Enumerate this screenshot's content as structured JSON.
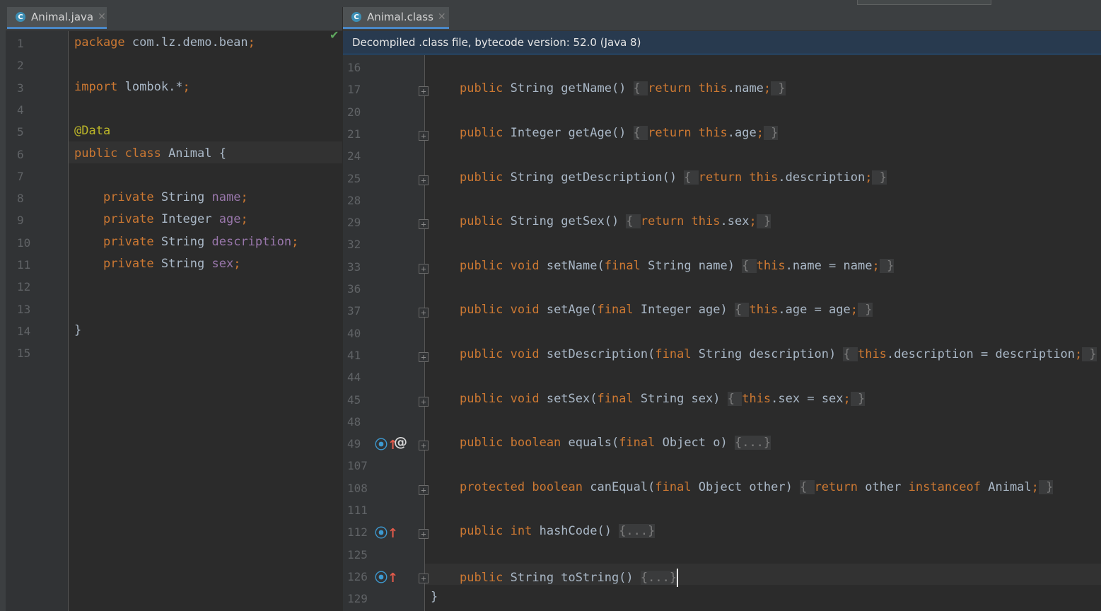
{
  "tabs": {
    "left": {
      "label": "Animal.java",
      "icon": "C"
    },
    "right": {
      "label": "Animal.class",
      "icon": "C"
    }
  },
  "banner": "Decompiled .class file, bytecode version: 52.0 (Java 8)",
  "left_editor": {
    "line_numbers": [
      "1",
      "2",
      "3",
      "4",
      "5",
      "6",
      "7",
      "8",
      "9",
      "10",
      "11",
      "12",
      "13",
      "14",
      "15"
    ],
    "lines": [
      {
        "n": "1",
        "tokens": [
          [
            "kw",
            "package"
          ],
          [
            "pl",
            " com.lz.demo.bean"
          ],
          [
            "kw",
            ";"
          ]
        ]
      },
      {
        "n": "2",
        "tokens": []
      },
      {
        "n": "3",
        "tokens": [
          [
            "kw",
            "import"
          ],
          [
            "pl",
            " lombok.*"
          ],
          [
            "kw",
            ";"
          ]
        ]
      },
      {
        "n": "4",
        "tokens": []
      },
      {
        "n": "5",
        "tokens": [
          [
            "ann",
            "@Data"
          ]
        ]
      },
      {
        "n": "6",
        "tokens": [
          [
            "kw",
            "public class"
          ],
          [
            "pl",
            " Animal {"
          ]
        ]
      },
      {
        "n": "7",
        "tokens": []
      },
      {
        "n": "8",
        "tokens": [
          [
            "pl",
            "    "
          ],
          [
            "kw",
            "private"
          ],
          [
            "pl",
            " String "
          ],
          [
            "fld",
            "name"
          ],
          [
            "kw",
            ";"
          ]
        ]
      },
      {
        "n": "9",
        "tokens": [
          [
            "pl",
            "    "
          ],
          [
            "kw",
            "private"
          ],
          [
            "pl",
            " Integer "
          ],
          [
            "fld",
            "age"
          ],
          [
            "kw",
            ";"
          ]
        ]
      },
      {
        "n": "10",
        "tokens": [
          [
            "pl",
            "    "
          ],
          [
            "kw",
            "private"
          ],
          [
            "pl",
            " String "
          ],
          [
            "fld",
            "description"
          ],
          [
            "kw",
            ";"
          ]
        ]
      },
      {
        "n": "11",
        "tokens": [
          [
            "pl",
            "    "
          ],
          [
            "kw",
            "private"
          ],
          [
            "pl",
            " String "
          ],
          [
            "fld",
            "sex"
          ],
          [
            "kw",
            ";"
          ]
        ]
      },
      {
        "n": "12",
        "tokens": []
      },
      {
        "n": "13",
        "tokens": []
      },
      {
        "n": "14",
        "tokens": [
          [
            "pl",
            "}"
          ]
        ]
      },
      {
        "n": "15",
        "tokens": []
      }
    ]
  },
  "right_editor": {
    "lines": [
      {
        "n": "16",
        "tokens": []
      },
      {
        "n": "17",
        "tokens": [
          [
            "kw",
            "public"
          ],
          [
            "pl",
            " String getName() "
          ],
          [
            "br",
            "{ "
          ],
          [
            "kw",
            "return this"
          ],
          [
            "pl",
            ".name"
          ],
          [
            "kw",
            ";"
          ],
          [
            "br",
            " }"
          ]
        ]
      },
      {
        "n": "20",
        "tokens": []
      },
      {
        "n": "21",
        "tokens": [
          [
            "kw",
            "public"
          ],
          [
            "pl",
            " Integer getAge() "
          ],
          [
            "br",
            "{ "
          ],
          [
            "kw",
            "return this"
          ],
          [
            "pl",
            ".age"
          ],
          [
            "kw",
            ";"
          ],
          [
            "br",
            " }"
          ]
        ]
      },
      {
        "n": "24",
        "tokens": []
      },
      {
        "n": "25",
        "tokens": [
          [
            "kw",
            "public"
          ],
          [
            "pl",
            " String getDescription() "
          ],
          [
            "br",
            "{ "
          ],
          [
            "kw",
            "return this"
          ],
          [
            "pl",
            ".description"
          ],
          [
            "kw",
            ";"
          ],
          [
            "br",
            " }"
          ]
        ]
      },
      {
        "n": "28",
        "tokens": []
      },
      {
        "n": "29",
        "tokens": [
          [
            "kw",
            "public"
          ],
          [
            "pl",
            " String getSex() "
          ],
          [
            "br",
            "{ "
          ],
          [
            "kw",
            "return this"
          ],
          [
            "pl",
            ".sex"
          ],
          [
            "kw",
            ";"
          ],
          [
            "br",
            " }"
          ]
        ]
      },
      {
        "n": "32",
        "tokens": []
      },
      {
        "n": "33",
        "tokens": [
          [
            "kw",
            "public void"
          ],
          [
            "pl",
            " setName("
          ],
          [
            "kw",
            "final"
          ],
          [
            "pl",
            " String name) "
          ],
          [
            "br",
            "{ "
          ],
          [
            "kw",
            "this"
          ],
          [
            "pl",
            ".name = name"
          ],
          [
            "kw",
            ";"
          ],
          [
            "br",
            " }"
          ]
        ]
      },
      {
        "n": "36",
        "tokens": []
      },
      {
        "n": "37",
        "tokens": [
          [
            "kw",
            "public void"
          ],
          [
            "pl",
            " setAge("
          ],
          [
            "kw",
            "final"
          ],
          [
            "pl",
            " Integer age) "
          ],
          [
            "br",
            "{ "
          ],
          [
            "kw",
            "this"
          ],
          [
            "pl",
            ".age = age"
          ],
          [
            "kw",
            ";"
          ],
          [
            "br",
            " }"
          ]
        ]
      },
      {
        "n": "40",
        "tokens": []
      },
      {
        "n": "41",
        "tokens": [
          [
            "kw",
            "public void"
          ],
          [
            "pl",
            " setDescription("
          ],
          [
            "kw",
            "final"
          ],
          [
            "pl",
            " String description) "
          ],
          [
            "br",
            "{ "
          ],
          [
            "kw",
            "this"
          ],
          [
            "pl",
            ".description = description"
          ],
          [
            "kw",
            ";"
          ],
          [
            "br",
            " }"
          ]
        ]
      },
      {
        "n": "44",
        "tokens": []
      },
      {
        "n": "45",
        "tokens": [
          [
            "kw",
            "public void"
          ],
          [
            "pl",
            " setSex("
          ],
          [
            "kw",
            "final"
          ],
          [
            "pl",
            " String sex) "
          ],
          [
            "br",
            "{ "
          ],
          [
            "kw",
            "this"
          ],
          [
            "pl",
            ".sex = sex"
          ],
          [
            "kw",
            ";"
          ],
          [
            "br",
            " }"
          ]
        ]
      },
      {
        "n": "48",
        "tokens": []
      },
      {
        "n": "49",
        "tokens": [
          [
            "kw",
            "public boolean"
          ],
          [
            "pl",
            " equals("
          ],
          [
            "kw",
            "final"
          ],
          [
            "pl",
            " Object o) "
          ],
          [
            "br",
            "{...}"
          ]
        ]
      },
      {
        "n": "107",
        "tokens": []
      },
      {
        "n": "108",
        "tokens": [
          [
            "kw",
            "protected boolean"
          ],
          [
            "pl",
            " canEqual("
          ],
          [
            "kw",
            "final"
          ],
          [
            "pl",
            " Object other) "
          ],
          [
            "br",
            "{ "
          ],
          [
            "kw",
            "return"
          ],
          [
            "pl",
            " other "
          ],
          [
            "kw",
            "instanceof"
          ],
          [
            "pl",
            " Animal"
          ],
          [
            "kw",
            ";"
          ],
          [
            "br",
            " }"
          ]
        ]
      },
      {
        "n": "111",
        "tokens": []
      },
      {
        "n": "112",
        "tokens": [
          [
            "kw",
            "public int"
          ],
          [
            "pl",
            " hashCode() "
          ],
          [
            "br",
            "{...}"
          ]
        ]
      },
      {
        "n": "125",
        "tokens": []
      },
      {
        "n": "126",
        "tokens": [
          [
            "kw",
            "public"
          ],
          [
            "pl",
            " String toString() "
          ],
          [
            "br",
            "{...}"
          ]
        ]
      },
      {
        "n": "129",
        "tokens": []
      }
    ],
    "closing_brace": "}"
  },
  "gutter_icons": {
    "override": "o↑",
    "annotation": "@"
  },
  "colors": {
    "keyword": "#cc7832",
    "plain": "#a9b7c6",
    "field": "#9876aa",
    "annotation": "#bbb529",
    "accent": "#4a88c7"
  }
}
